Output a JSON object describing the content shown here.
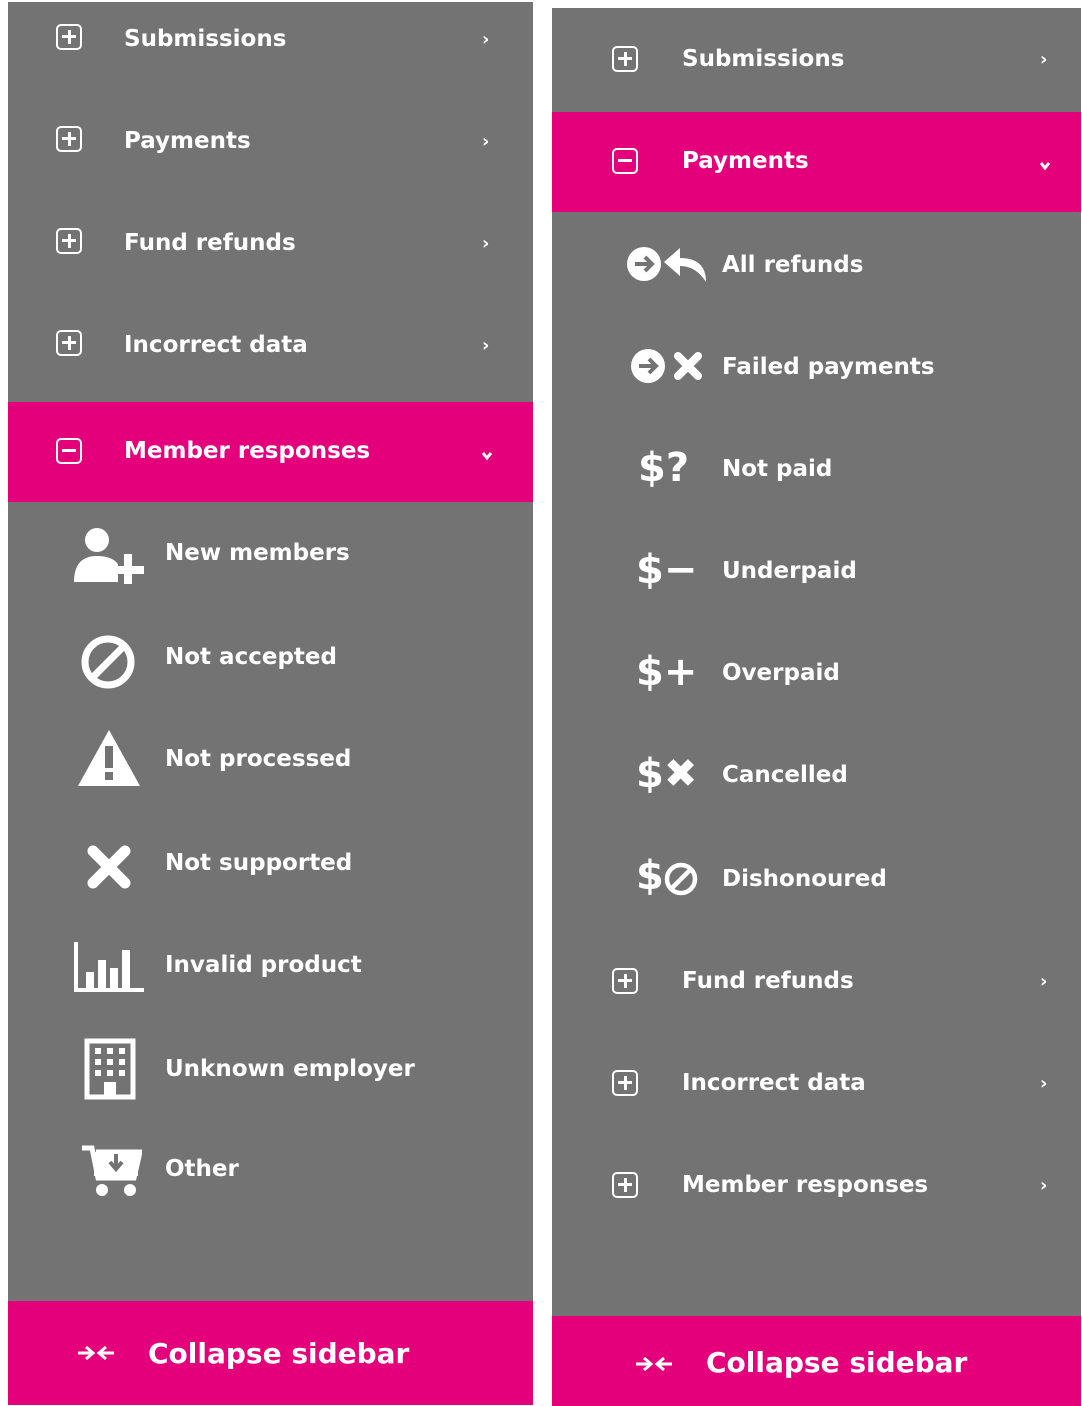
{
  "left_panel": {
    "items": [
      {
        "label": "Submissions",
        "expanded": false
      },
      {
        "label": "Payments",
        "expanded": false
      },
      {
        "label": "Fund refunds",
        "expanded": false
      },
      {
        "label": "Incorrect data",
        "expanded": false
      },
      {
        "label": "Member responses",
        "expanded": true
      }
    ],
    "subitems": [
      {
        "label": "New members",
        "icon": "add-user-icon"
      },
      {
        "label": "Not accepted",
        "icon": "ban-icon"
      },
      {
        "label": "Not processed",
        "icon": "warning-icon"
      },
      {
        "label": "Not supported",
        "icon": "x-icon"
      },
      {
        "label": "Invalid product",
        "icon": "bar-chart-icon"
      },
      {
        "label": "Unknown employer",
        "icon": "building-icon"
      },
      {
        "label": "Other",
        "icon": "cart-download-icon"
      }
    ],
    "footer": {
      "label": "Collapse sidebar",
      "icon": "collapse-arrows-icon"
    }
  },
  "right_panel": {
    "items": [
      {
        "label": "Submissions",
        "expanded": false
      },
      {
        "label": "Payments",
        "expanded": true
      },
      {
        "label": "Fund refunds",
        "expanded": false
      },
      {
        "label": "Incorrect data",
        "expanded": false
      },
      {
        "label": "Member responses",
        "expanded": false
      }
    ],
    "subitems": [
      {
        "label": "All refunds",
        "icon": "arrow-reply-icon"
      },
      {
        "label": "Failed payments",
        "icon": "arrow-x-icon"
      },
      {
        "label": "Not paid",
        "icon": "dollar-question-icon",
        "glyph": "$?"
      },
      {
        "label": "Underpaid",
        "icon": "dollar-minus-icon",
        "glyph": "$−"
      },
      {
        "label": "Overpaid",
        "icon": "dollar-plus-icon",
        "glyph": "$+"
      },
      {
        "label": "Cancelled",
        "icon": "dollar-x-icon",
        "glyph": "$✖"
      },
      {
        "label": "Dishonoured",
        "icon": "dollar-ban-icon",
        "glyph": "$"
      }
    ],
    "footer": {
      "label": "Collapse sidebar",
      "icon": "collapse-arrows-icon"
    }
  },
  "colors": {
    "sidebar_bg": "#737373",
    "accent": "#e3007a",
    "text": "#ffffff"
  }
}
